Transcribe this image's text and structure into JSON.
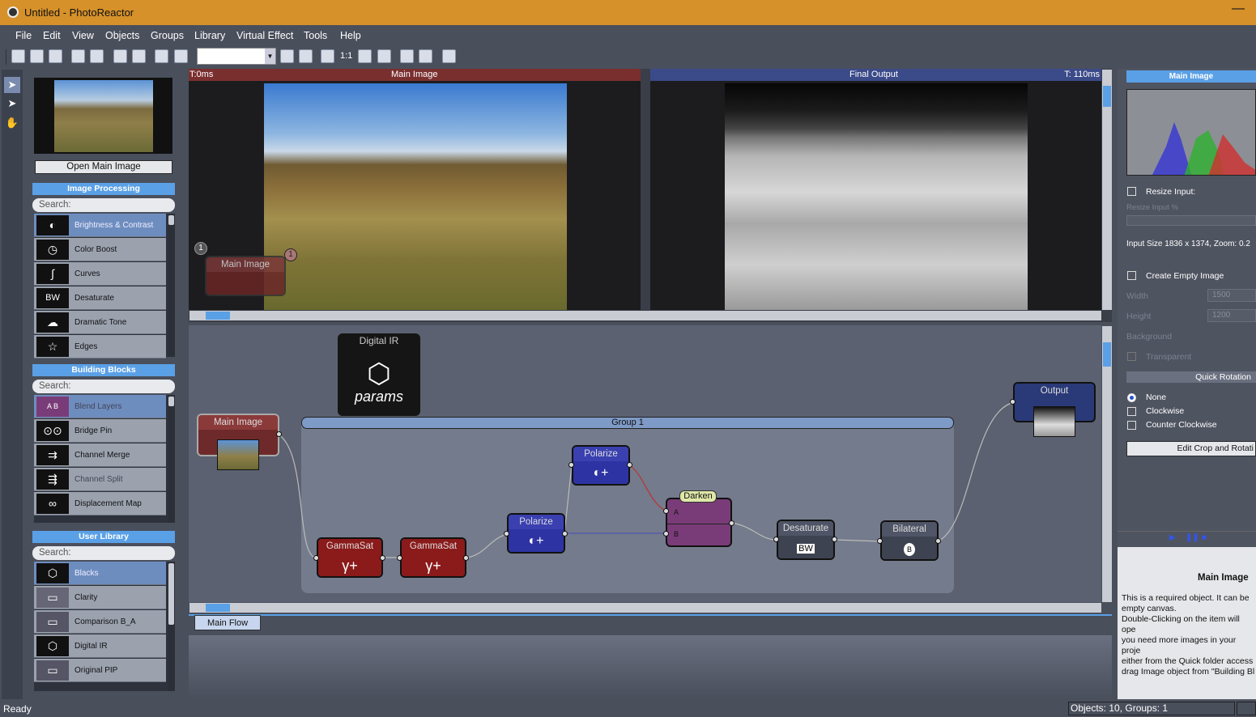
{
  "window": {
    "title": "Untitled - PhotoReactor",
    "minimize": "—"
  },
  "menu": [
    "File",
    "Edit",
    "View",
    "Objects",
    "Groups",
    "Library",
    "Virtual Effect",
    "Tools",
    "Help"
  ],
  "toolbar": {
    "zoom_label": "1:1"
  },
  "left_panel": {
    "open_button": "Open Main Image",
    "image_processing": {
      "title": "Image Processing",
      "search": "Search:",
      "items": [
        "Brightness & Contrast",
        "Color Boost",
        "Curves",
        "Desaturate",
        "Dramatic Tone",
        "Edges"
      ]
    },
    "building_blocks": {
      "title": "Building Blocks",
      "search": "Search:",
      "items": [
        "Blend Layers",
        "Bridge Pin",
        "Channel Merge",
        "Channel Split",
        "Displacement Map"
      ]
    },
    "user_library": {
      "title": "User Library",
      "search": "Search:",
      "items": [
        "Blacks",
        "Clarity",
        "Comparison B_A",
        "Digital IR",
        "Original PIP"
      ]
    }
  },
  "viewers": {
    "main": {
      "timing": "T:0ms",
      "title": "Main Image",
      "badge": "1",
      "overlay_node": "Main Image",
      "overlay_badge": "1"
    },
    "final": {
      "title": "Final Output",
      "timing": "T: 110ms"
    }
  },
  "flow": {
    "params_node": {
      "title": "Digital IR",
      "label": "params"
    },
    "group_title": "Group 1",
    "nodes": {
      "main_image": "Main Image",
      "gammasat1": "GammaSat",
      "gammasat2": "GammaSat",
      "polarize1": "Polarize",
      "polarize2": "Polarize",
      "darken": "Darken",
      "desaturate": "Desaturate",
      "bilateral": "Bilateral",
      "output": "Output"
    },
    "darken_pins": {
      "a": "A",
      "b": "B"
    },
    "glyphs": {
      "gamma": "γ+",
      "polarize": "◐+",
      "bw": "BW",
      "bilateral": "B"
    },
    "tab": "Main Flow"
  },
  "right_panel": {
    "header": "Main Image",
    "resize_input": "Resize Input:",
    "resize_input_pct": "Resize Input %",
    "input_size": "Input Size 1836 x 1374, Zoom: 0.2",
    "create_empty": "Create Empty Image",
    "width_label": "Width",
    "width_value": "1500",
    "height_label": "Height",
    "height_value": "1200",
    "background_label": "Background",
    "transparent_label": "Transparent",
    "quick_rotation": "Quick Rotation",
    "rotation_options": [
      "None",
      "Clockwise",
      "Counter Clockwise"
    ],
    "edit_crop": "Edit Crop and Rotati",
    "info_title": "Main Image",
    "info_lines": [
      "This is a required object. It can be",
      "empty canvas.",
      "Double-Clicking on the item will ope",
      "you need more images in your proje",
      "either from the Quick folder access",
      "drag Image object from \"Building Bl"
    ]
  },
  "status": {
    "left": "Ready",
    "right": "Objects: 10, Groups: 1"
  },
  "colors": {
    "titlebar": "#d6912a",
    "accent": "#5aa0e6",
    "node_red": "#8b1a1a",
    "node_blue": "#2e33a3",
    "node_purple": "#7a3c78"
  }
}
